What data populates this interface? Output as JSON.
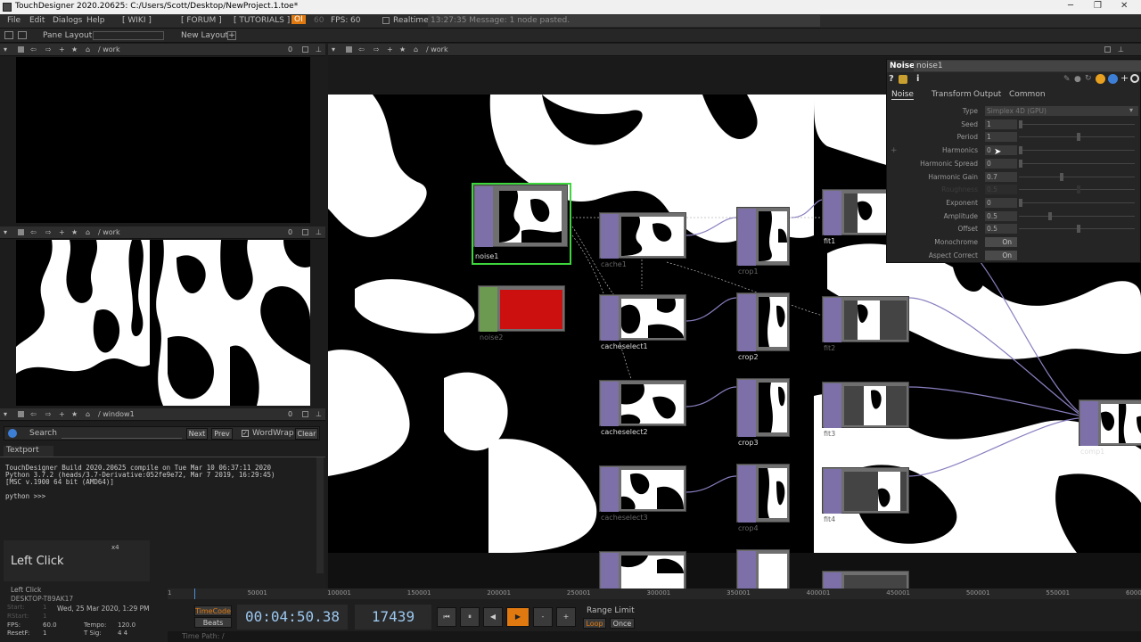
{
  "window": {
    "title": "TouchDesigner 2020.20625: C:/Users/Scott/Desktop/NewProject.1.toe*",
    "minimize": "─",
    "restore": "❐",
    "close": "✕"
  },
  "menubar": {
    "items": [
      "File",
      "Edit",
      "Dialogs",
      "Help",
      "[ WIKI ]",
      "[ FORUM ]",
      "[ TUTORIALS ]"
    ],
    "oi": "OI",
    "fps_num": "60",
    "fps_label": "FPS:",
    "fps_val": "60",
    "realtime": "Realtime",
    "message": "13:27:35 Message: 1 node pasted."
  },
  "toolbar": {
    "pane_layout": "Pane Layout",
    "new_layout": "New Layout"
  },
  "panes": {
    "top_left_path": "/ work",
    "mid_left_path": "/ work",
    "console_path": "/ window1",
    "network_path": "/ work",
    "zero": "0"
  },
  "search": {
    "label": "Search",
    "next": "Next",
    "prev": "Prev",
    "wordwrap": "WordWrap",
    "clear": "Clear"
  },
  "textport": {
    "tab": "Textport",
    "lines": [
      "TouchDesigner  Build 2020.20625 compile on Tue Mar 10 06:37:11 2020",
      "Python 3.7.2 (heads/3.7-Derivative:052fe9e72, Mar  7 2019, 16:29:45)",
      "[MSC v.1900 64 bit (AMD64)]",
      "",
      "python >>>"
    ]
  },
  "overlay": {
    "left_click_big": "Left Click",
    "x4": "x4",
    "left_click_small": "Left Click",
    "machine": "DESKTOP-T89AK17",
    "date": "Wed, 25 Mar 2020, 1:29 PM",
    "fps_label": "FPS:",
    "fps": "60.0",
    "tempo_label": "Tempo:",
    "tempo": "120.0",
    "resetf_label": "ResetF:",
    "resetf": "1",
    "tsig_label": "T Sig:",
    "tsig": "4   4",
    "start_label": "Start:",
    "start": "1",
    "rstart_label": "RStart:",
    "rstart": "1"
  },
  "params": {
    "op_type": "Noise",
    "op_name": "noise1",
    "help": "?",
    "info": "i",
    "tabs": [
      "Noise",
      "Transform",
      "Output",
      "Common"
    ],
    "rows": [
      {
        "label": "Type",
        "value": "Simplex 4D (GPU)",
        "kind": "menu"
      },
      {
        "label": "Seed",
        "value": "1",
        "kind": "slider",
        "pos": 0
      },
      {
        "label": "Period",
        "value": "1",
        "kind": "slider",
        "pos": 0.5
      },
      {
        "label": "Harmonics",
        "value": "0",
        "kind": "slider",
        "pos": 0
      },
      {
        "label": "Harmonic Spread",
        "value": "0",
        "kind": "slider",
        "pos": 0
      },
      {
        "label": "Harmonic Gain",
        "value": "0.7",
        "kind": "slider",
        "pos": 0.35
      },
      {
        "label": "Roughness",
        "value": "0.5",
        "kind": "disabled",
        "pos": 0.5
      },
      {
        "label": "Exponent",
        "value": "0",
        "kind": "slider",
        "pos": 0
      },
      {
        "label": "Amplitude",
        "value": "0.5",
        "kind": "slider",
        "pos": 0.25
      },
      {
        "label": "Offset",
        "value": "0.5",
        "kind": "slider",
        "pos": 0.5
      },
      {
        "label": "Monochrome",
        "value": "On",
        "kind": "toggle"
      },
      {
        "label": "Aspect Correct",
        "value": "On",
        "kind": "toggle"
      }
    ]
  },
  "nodes": {
    "noise1": "noise1",
    "cache": "cache1",
    "noise2": "noise2",
    "cacheselect1": "cacheselect1",
    "cacheselect2": "cacheselect2",
    "cacheselect3": "cacheselect3",
    "crop1": "crop1",
    "crop2": "crop2",
    "crop3": "crop3",
    "crop4": "crop4",
    "fit1": "fit1",
    "fit2": "fit2",
    "fit3": "fit3",
    "fit4": "fit4",
    "comp1": "comp1"
  },
  "timeline": {
    "ticks": [
      "1",
      "50001",
      "100001",
      "150001",
      "200001",
      "250001",
      "300001",
      "350001",
      "400001",
      "450001",
      "500001",
      "550001",
      "600001"
    ],
    "timecode_btn": "TimeCode",
    "beats_btn": "Beats",
    "timecode": "00:04:50.38",
    "frame": "17439",
    "range_limit": "Range Limit",
    "loop": "Loop",
    "once": "Once",
    "time_path": "Time Path: /",
    "minus": "-",
    "plus": "+"
  },
  "colors": {
    "accent_orange": "#e07a10",
    "selected_green": "#3dd63d",
    "top_purple": "#7d6fa8",
    "noise2_red": "#cc1010"
  }
}
